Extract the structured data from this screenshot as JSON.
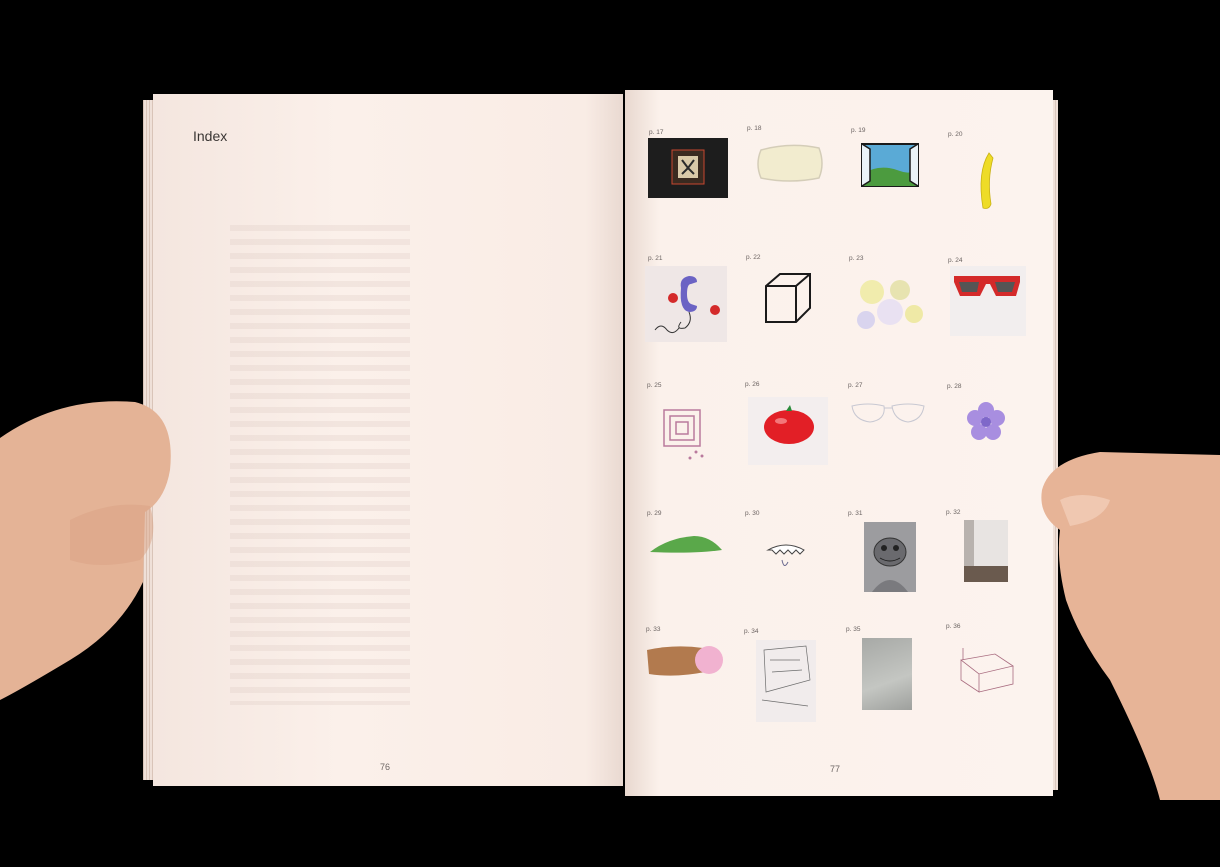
{
  "book": {
    "left_page": {
      "heading": "Index",
      "page_number": "76"
    },
    "right_page": {
      "page_number": "77"
    }
  },
  "index_entries": [
    {
      "label": "p. 17",
      "icon": "framed-image-icon"
    },
    {
      "label": "p. 18",
      "icon": "pillow-icon"
    },
    {
      "label": "p. 19",
      "icon": "window-icon"
    },
    {
      "label": "p. 20",
      "icon": "banana-icon"
    },
    {
      "label": "p. 21",
      "icon": "phone-cherries-icon"
    },
    {
      "label": "p. 22",
      "icon": "cube-icon"
    },
    {
      "label": "p. 23",
      "icon": "flowers-icon"
    },
    {
      "label": "p. 24",
      "icon": "sunglasses-icon"
    },
    {
      "label": "p. 25",
      "icon": "pattern-icon"
    },
    {
      "label": "p. 26",
      "icon": "tomato-icon"
    },
    {
      "label": "p. 27",
      "icon": "glasses-sketch-icon"
    },
    {
      "label": "p. 28",
      "icon": "violet-flower-icon"
    },
    {
      "label": "p. 29",
      "icon": "leaf-icon"
    },
    {
      "label": "p. 30",
      "icon": "jaw-sketch-icon"
    },
    {
      "label": "p. 31",
      "icon": "gorilla-photo-icon"
    },
    {
      "label": "p. 32",
      "icon": "room-corner-photo-icon"
    },
    {
      "label": "p. 33",
      "icon": "finger-icon"
    },
    {
      "label": "p. 34",
      "icon": "sketch-icon"
    },
    {
      "label": "p. 35",
      "icon": "grey-photo-icon"
    },
    {
      "label": "p. 36",
      "icon": "bed-sketch-icon"
    }
  ],
  "colors": {
    "background": "#000000",
    "paper": "#fbf0ea",
    "text": "#3a3634"
  }
}
